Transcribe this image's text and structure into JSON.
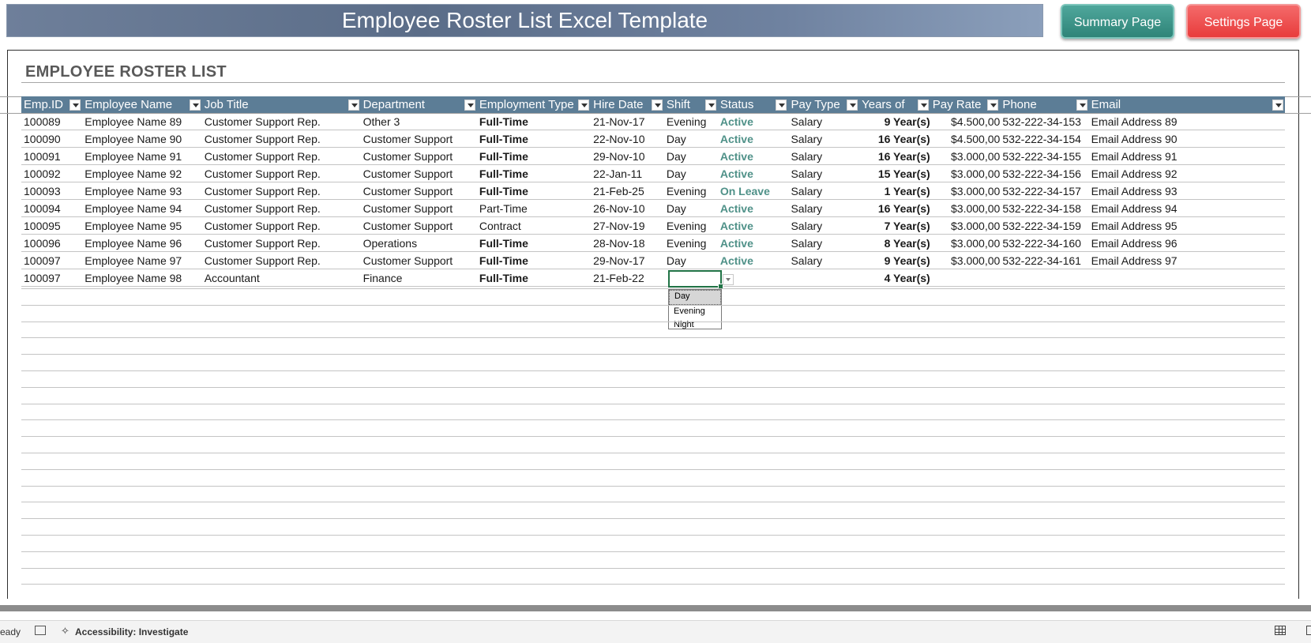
{
  "header": {
    "title": "Employee Roster List Excel Template",
    "summary_button": "Summary Page",
    "settings_button": "Settings Page"
  },
  "section_title": "EMPLOYEE ROSTER LIST",
  "columns": [
    "Emp.ID",
    "Employee Name",
    "Job Title",
    "Department",
    "Employment Type",
    "Hire Date",
    "Shift",
    "Status",
    "Pay Type",
    "Years of",
    "Pay Rate",
    "Phone",
    "Email"
  ],
  "rows": [
    [
      "100089",
      "Employee Name 89",
      "Customer Support Rep.",
      "Other 3",
      "Full-Time",
      "21-Nov-17",
      "Evening",
      "Active",
      "Salary",
      "9 Year(s)",
      "$4.500,00",
      "532-222-34-153",
      "Email Address 89"
    ],
    [
      "100090",
      "Employee Name 90",
      "Customer Support Rep.",
      "Customer Support",
      "Full-Time",
      "22-Nov-10",
      "Day",
      "Active",
      "Salary",
      "16 Year(s)",
      "$4.500,00",
      "532-222-34-154",
      "Email Address 90"
    ],
    [
      "100091",
      "Employee Name 91",
      "Customer Support Rep.",
      "Customer Support",
      "Full-Time",
      "29-Nov-10",
      "Day",
      "Active",
      "Salary",
      "16 Year(s)",
      "$3.000,00",
      "532-222-34-155",
      "Email Address 91"
    ],
    [
      "100092",
      "Employee Name 92",
      "Customer Support Rep.",
      "Customer Support",
      "Full-Time",
      "22-Jan-11",
      "Day",
      "Active",
      "Salary",
      "15 Year(s)",
      "$3.000,00",
      "532-222-34-156",
      "Email Address 92"
    ],
    [
      "100093",
      "Employee Name 93",
      "Customer Support Rep.",
      "Customer Support",
      "Full-Time",
      "21-Feb-25",
      "Evening",
      "On Leave",
      "Salary",
      "1 Year(s)",
      "$3.000,00",
      "532-222-34-157",
      "Email Address 93"
    ],
    [
      "100094",
      "Employee Name 94",
      "Customer Support Rep.",
      "Customer Support",
      "Part-Time",
      "26-Nov-10",
      "Day",
      "Active",
      "Salary",
      "16 Year(s)",
      "$3.000,00",
      "532-222-34-158",
      "Email Address 94"
    ],
    [
      "100095",
      "Employee Name 95",
      "Customer Support Rep.",
      "Customer Support",
      "Contract",
      "27-Nov-19",
      "Evening",
      "Active",
      "Salary",
      "7 Year(s)",
      "$3.000,00",
      "532-222-34-159",
      "Email Address 95"
    ],
    [
      "100096",
      "Employee Name 96",
      "Customer Support Rep.",
      "Operations",
      "Full-Time",
      "28-Nov-18",
      "Evening",
      "Active",
      "Salary",
      "8 Year(s)",
      "$3.000,00",
      "532-222-34-160",
      "Email Address 96"
    ],
    [
      "100097",
      "Employee Name 97",
      "Customer Support Rep.",
      "Customer Support",
      "Full-Time",
      "29-Nov-17",
      "Day",
      "Active",
      "Salary",
      "9 Year(s)",
      "$3.000,00",
      "532-222-34-161",
      "Email Address 97"
    ],
    [
      "100097",
      "Employee Name 98",
      "Accountant",
      "Finance",
      "Full-Time",
      "21-Feb-22",
      "",
      "",
      "",
      "4 Year(s)",
      "",
      "",
      ""
    ]
  ],
  "shift_dropdown": {
    "options": [
      "Day",
      "Evening",
      "Night"
    ],
    "highlighted": "Day"
  },
  "statusbar": {
    "ready": "eady",
    "accessibility": "Accessibility: Investigate"
  },
  "colors": {
    "header_fill": "#5c7d96",
    "status_text": "#4f9188",
    "summary_button": "#2f8478",
    "settings_button": "#e83c3c"
  }
}
